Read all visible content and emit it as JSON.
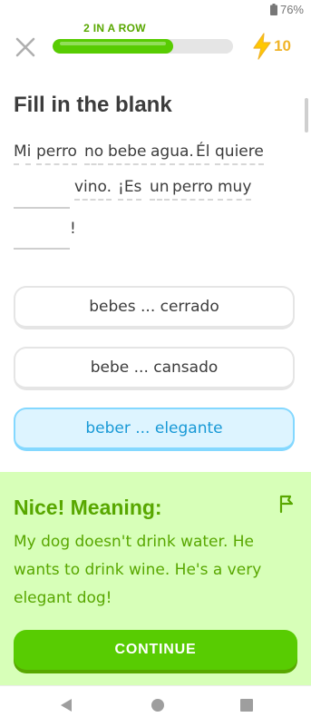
{
  "status_bar": {
    "battery": "76%"
  },
  "header": {
    "streak_label": "2 IN A ROW",
    "progress": 0.67,
    "energy_count": "10"
  },
  "challenge": {
    "title": "Fill in the blank",
    "sentence_words": [
      "Mi",
      "perro",
      "no",
      "bebe",
      "agua.",
      "Él",
      "quiere",
      "vino.",
      "¡Es",
      "un",
      "perro",
      "muy"
    ],
    "end_punctuation": "!"
  },
  "options": [
    {
      "label": "bebes ... cerrado",
      "selected": false
    },
    {
      "label": "bebe ... cansado",
      "selected": false
    },
    {
      "label": "beber ... elegante",
      "selected": true
    }
  ],
  "feedback": {
    "title": "Nice! Meaning:",
    "translation": "My dog doesn't drink water. He wants to drink wine. He's a very elegant dog!",
    "continue_label": "CONTINUE"
  },
  "colors": {
    "accent_green": "#58cc02",
    "feedback_bg": "#d7ffb8",
    "selected_blue": "#1899d6",
    "energy_yellow": "#f0b429"
  }
}
